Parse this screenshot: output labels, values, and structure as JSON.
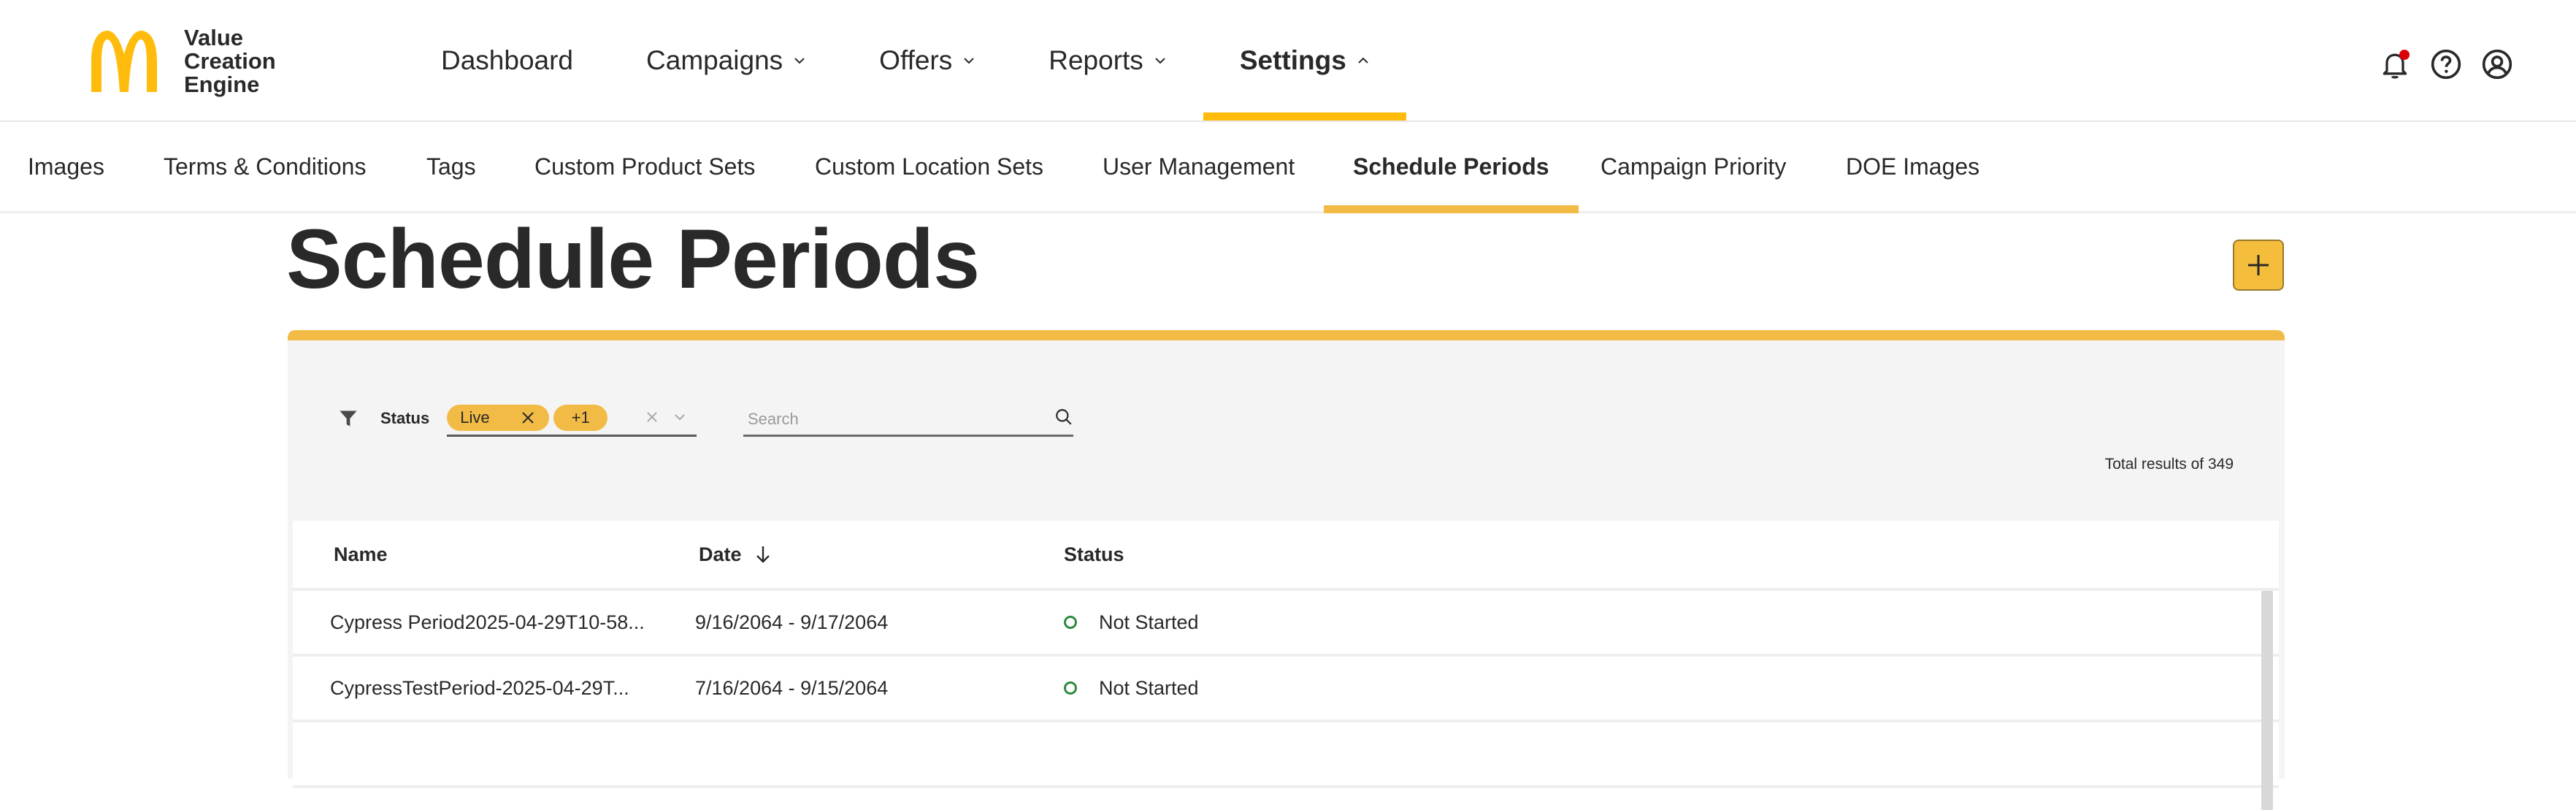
{
  "brand": {
    "line1": "Value",
    "line2": "Creation",
    "line3": "Engine"
  },
  "main_nav": [
    {
      "label": "Dashboard",
      "has_menu": false
    },
    {
      "label": "Campaigns",
      "has_menu": true
    },
    {
      "label": "Offers",
      "has_menu": true
    },
    {
      "label": "Reports",
      "has_menu": true
    },
    {
      "label": "Settings",
      "has_menu": true,
      "active": true
    }
  ],
  "tools": [
    "bell-icon",
    "help-icon",
    "account-icon"
  ],
  "sub_nav": [
    "Images",
    "Terms & Conditions",
    "Tags",
    "Custom Product Sets",
    "Custom Location Sets",
    "User Management",
    "Schedule Periods",
    "Campaign Priority",
    "DOE Images"
  ],
  "sub_nav_active": "Schedule Periods",
  "page": {
    "title": "Schedule Periods",
    "add_icon": "plus-icon"
  },
  "filters": {
    "status_label": "Status",
    "chip_live": "Live",
    "chip_more": "+1",
    "search_placeholder": "Search"
  },
  "total_results": "Total results of 349",
  "table": {
    "headers": {
      "name": "Name",
      "date": "Date",
      "status": "Status"
    },
    "rows": [
      {
        "name": "Cypress Period2025-04-29T10-58...",
        "date": "9/16/2064 - 9/17/2064",
        "status": "Not Started"
      },
      {
        "name": "CypressTestPeriod-2025-04-29T...",
        "date": "7/16/2064 - 9/15/2064",
        "status": "Not Started"
      }
    ]
  },
  "colors": {
    "accent": "#f2bb46",
    "logo": "#ffbc0d",
    "notification": "#db0007",
    "status_not_started": "#2e8b3d"
  }
}
